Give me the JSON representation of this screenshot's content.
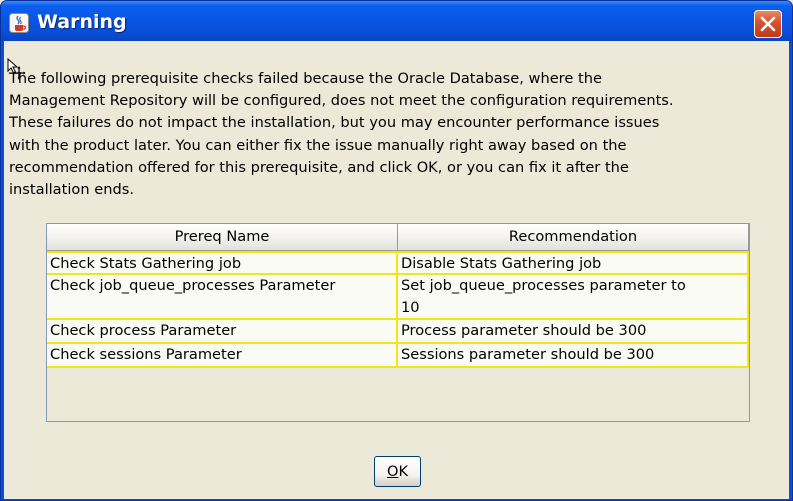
{
  "window": {
    "title": "Warning",
    "title_color": "#ffffff",
    "titlebar_color": "#0a4fd8",
    "close_color": "#d9552f"
  },
  "message": {
    "text": "The following prerequisite checks failed because the Oracle Database, where the\nManagement Repository will be configured, does not meet the configuration requirements.\nThese failures do not impact the installation, but you may encounter performance issues\nwith the product later. You can either fix the issue manually right away based on the\nrecommendation offered for this prerequisite, and click OK, or you can fix it after the\ninstallation ends."
  },
  "table": {
    "columns": [
      "Prereq Name",
      "Recommendation"
    ],
    "row_border_color": "#f2e61a",
    "rows": [
      {
        "name": "Check Stats Gathering job",
        "recommendation": "Disable Stats Gathering job"
      },
      {
        "name": "Check job_queue_processes Parameter",
        "recommendation": "Set job_queue_processes parameter to\n10"
      },
      {
        "name": "Check process Parameter",
        "recommendation": "Process parameter should be 300"
      },
      {
        "name": "Check sessions Parameter",
        "recommendation": "Sessions parameter should be 300"
      }
    ]
  },
  "buttons": {
    "ok_mnemonic": "O",
    "ok_rest": "K"
  },
  "icons": {
    "app": "java-cup-icon",
    "close": "close-icon",
    "cursor": "move-cursor-icon"
  }
}
